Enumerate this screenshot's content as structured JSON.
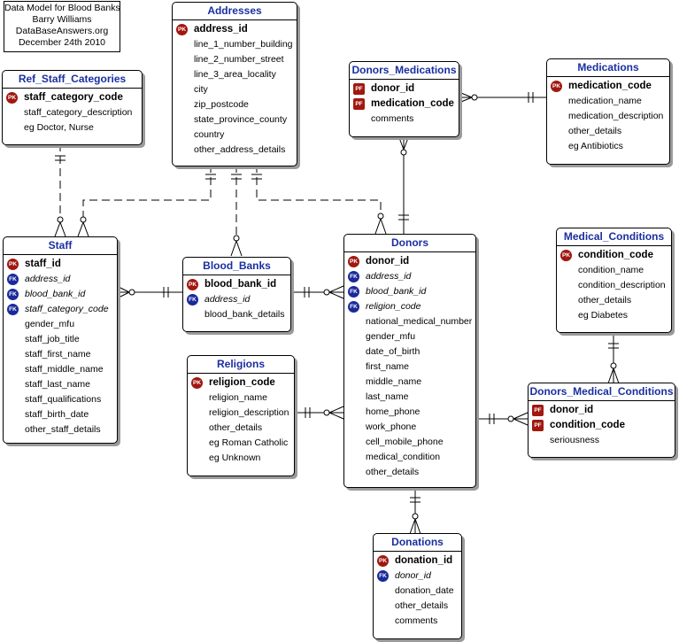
{
  "note": {
    "lines": [
      "Data Model for Blood Banks",
      "Barry Williams",
      "DataBaseAnswers.org",
      "December 24th 2010"
    ]
  },
  "entities": {
    "addresses": {
      "title": "Addresses",
      "attrs": [
        {
          "name": "address_id",
          "key": "PK"
        },
        {
          "name": "line_1_number_building"
        },
        {
          "name": "line_2_number_street"
        },
        {
          "name": "line_3_area_locality"
        },
        {
          "name": "city"
        },
        {
          "name": "zip_postcode"
        },
        {
          "name": "state_province_county"
        },
        {
          "name": "country"
        },
        {
          "name": "other_address_details"
        }
      ]
    },
    "ref_staff_categories": {
      "title": "Ref_Staff_Categories",
      "attrs": [
        {
          "name": "staff_category_code",
          "key": "PK"
        },
        {
          "name": "staff_category_description"
        },
        {
          "name": "eg Doctor, Nurse"
        }
      ]
    },
    "donors_medications": {
      "title": "Donors_Medications",
      "attrs": [
        {
          "name": "donor_id",
          "key": "PF"
        },
        {
          "name": "medication_code",
          "key": "PF"
        },
        {
          "name": "comments"
        }
      ]
    },
    "medications": {
      "title": "Medications",
      "attrs": [
        {
          "name": "medication_code",
          "key": "PK"
        },
        {
          "name": "medication_name"
        },
        {
          "name": "medication_description"
        },
        {
          "name": "other_details"
        },
        {
          "name": "eg Antibiotics"
        }
      ]
    },
    "staff": {
      "title": "Staff",
      "attrs": [
        {
          "name": "staff_id",
          "key": "PK"
        },
        {
          "name": "address_id",
          "key": "FK"
        },
        {
          "name": "blood_bank_id",
          "key": "FK"
        },
        {
          "name": "staff_category_code",
          "key": "FK"
        },
        {
          "name": "gender_mfu"
        },
        {
          "name": "staff_job_title"
        },
        {
          "name": "staff_first_name"
        },
        {
          "name": "staff_middle_name"
        },
        {
          "name": "staff_last_name"
        },
        {
          "name": "staff_qualifications"
        },
        {
          "name": "staff_birth_date"
        },
        {
          "name": "other_staff_details"
        }
      ]
    },
    "blood_banks": {
      "title": "Blood_Banks",
      "attrs": [
        {
          "name": "blood_bank_id",
          "key": "PK"
        },
        {
          "name": "address_id",
          "key": "FK"
        },
        {
          "name": "blood_bank_details"
        }
      ]
    },
    "donors": {
      "title": "Donors",
      "attrs": [
        {
          "name": "donor_id",
          "key": "PK"
        },
        {
          "name": "address_id",
          "key": "FK"
        },
        {
          "name": "blood_bank_id",
          "key": "FK"
        },
        {
          "name": "religion_code",
          "key": "FK"
        },
        {
          "name": "national_medical_number"
        },
        {
          "name": "gender_mfu"
        },
        {
          "name": "date_of_birth"
        },
        {
          "name": "first_name"
        },
        {
          "name": "middle_name"
        },
        {
          "name": "last_name"
        },
        {
          "name": "home_phone"
        },
        {
          "name": "work_phone"
        },
        {
          "name": "cell_mobile_phone"
        },
        {
          "name": "medical_condition"
        },
        {
          "name": "other_details"
        }
      ]
    },
    "medical_conditions": {
      "title": "Medical_Conditions",
      "attrs": [
        {
          "name": "condition_code",
          "key": "PK"
        },
        {
          "name": "condition_name"
        },
        {
          "name": "condition_description"
        },
        {
          "name": "other_details"
        },
        {
          "name": "eg Diabetes"
        }
      ]
    },
    "religions": {
      "title": "Religions",
      "attrs": [
        {
          "name": "religion_code",
          "key": "PK"
        },
        {
          "name": "religion_name"
        },
        {
          "name": "religion_description"
        },
        {
          "name": "other_details"
        },
        {
          "name": "eg Roman Catholic"
        },
        {
          "name": "eg Unknown"
        }
      ]
    },
    "donors_medical_conditions": {
      "title": "Donors_Medical_Conditions",
      "attrs": [
        {
          "name": "donor_id",
          "key": "PF"
        },
        {
          "name": "condition_code",
          "key": "PF"
        },
        {
          "name": "seriousness"
        }
      ]
    },
    "donations": {
      "title": "Donations",
      "attrs": [
        {
          "name": "donation_id",
          "key": "PK"
        },
        {
          "name": "donor_id",
          "key": "FK"
        },
        {
          "name": "donation_date"
        },
        {
          "name": "other_details"
        },
        {
          "name": "comments"
        }
      ]
    }
  },
  "relationships": [
    {
      "from": "addresses",
      "to": "staff",
      "style": "non-identifying"
    },
    {
      "from": "addresses",
      "to": "blood_banks",
      "style": "non-identifying"
    },
    {
      "from": "addresses",
      "to": "donors",
      "style": "non-identifying"
    },
    {
      "from": "ref_staff_categories",
      "to": "staff",
      "style": "non-identifying"
    },
    {
      "from": "blood_banks",
      "to": "staff",
      "style": "identifying"
    },
    {
      "from": "blood_banks",
      "to": "donors",
      "style": "identifying"
    },
    {
      "from": "religions",
      "to": "donors",
      "style": "identifying"
    },
    {
      "from": "donors",
      "to": "donors_medications",
      "style": "identifying"
    },
    {
      "from": "medications",
      "to": "donors_medications",
      "style": "identifying"
    },
    {
      "from": "donors",
      "to": "donors_medical_conditions",
      "style": "identifying"
    },
    {
      "from": "medical_conditions",
      "to": "donors_medical_conditions",
      "style": "identifying"
    },
    {
      "from": "donors",
      "to": "donations",
      "style": "identifying"
    }
  ],
  "colors": {
    "entity_title": "#1a2fa0",
    "pk_badge": "#a01810",
    "fk_badge": "#1a2a9a",
    "shadow": "#9a9a9a"
  }
}
